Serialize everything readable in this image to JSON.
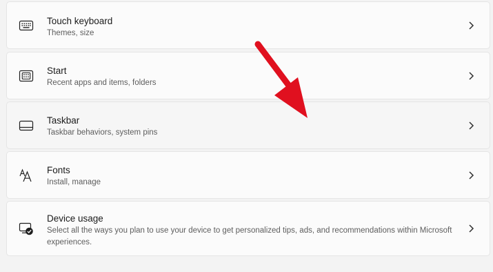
{
  "settings": {
    "items": [
      {
        "title": "Touch keyboard",
        "subtitle": "Themes, size",
        "icon": "keyboard-icon"
      },
      {
        "title": "Start",
        "subtitle": "Recent apps and items, folders",
        "icon": "start-icon"
      },
      {
        "title": "Taskbar",
        "subtitle": "Taskbar behaviors, system pins",
        "icon": "taskbar-icon"
      },
      {
        "title": "Fonts",
        "subtitle": "Install, manage",
        "icon": "fonts-icon"
      },
      {
        "title": "Device usage",
        "subtitle": "Select all the ways you plan to use your device to get personalized tips, ads, and recommendations within Microsoft experiences.",
        "icon": "device-usage-icon"
      }
    ]
  },
  "colors": {
    "page_background": "#f3f3f3",
    "card_background": "#fbfbfb",
    "card_border": "#e5e5e5",
    "annotation_arrow": "#e0101f"
  }
}
